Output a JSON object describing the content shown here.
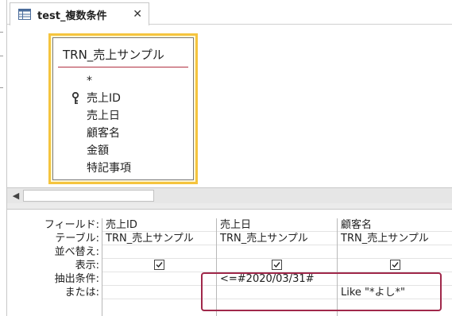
{
  "tab": {
    "title": "test_複数条件",
    "close_label": "✕"
  },
  "table": {
    "name": "TRN_売上サンプル",
    "fields": [
      "*",
      "売上ID",
      "売上日",
      "顧客名",
      "金額",
      "特記事項"
    ],
    "key_field_index": 1
  },
  "grid": {
    "row_labels": [
      "フィールド:",
      "テーブル:",
      "並べ替え:",
      "表示:",
      "抽出条件:",
      "または:"
    ],
    "columns": [
      {
        "field": "売上ID",
        "table": "TRN_売上サンプル",
        "sort": "",
        "show": true,
        "criteria": "",
        "or": ""
      },
      {
        "field": "売上日",
        "table": "TRN_売上サンプル",
        "sort": "",
        "show": true,
        "criteria": "<=#2020/03/31#",
        "or": ""
      },
      {
        "field": "顧客名",
        "table": "TRN_売上サンプル",
        "sort": "",
        "show": true,
        "criteria": "",
        "or": "Like \"*よし*\""
      }
    ]
  },
  "colors": {
    "highlight": "#a0284a",
    "table_border": "#f5c43e",
    "title_line": "#b03040"
  },
  "icons": [
    "query-icon",
    "close-icon",
    "key-icon",
    "scroll-left-icon",
    "checkbox-checked-icon"
  ]
}
